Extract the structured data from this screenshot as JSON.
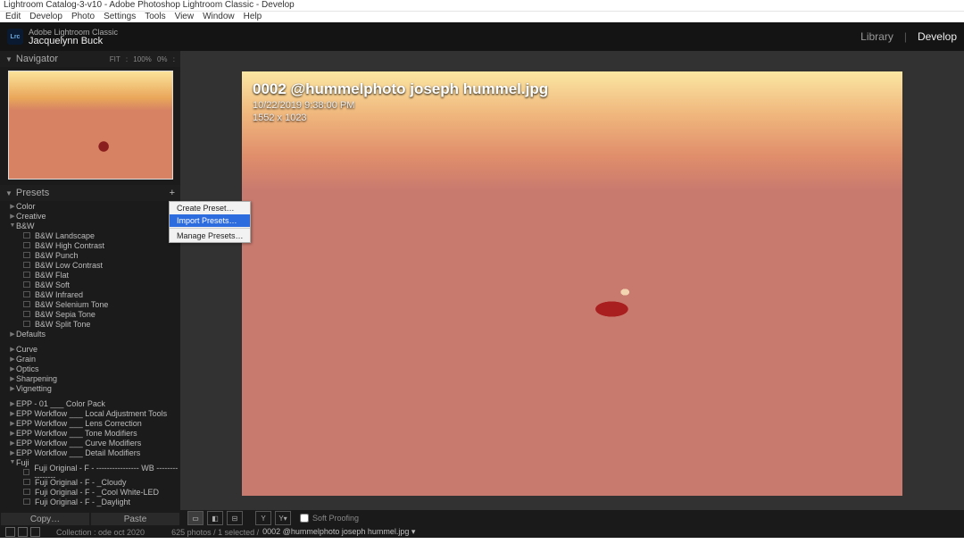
{
  "window_title": "Lightroom Catalog-3-v10 - Adobe Photoshop Lightroom Classic - Develop",
  "menubar": [
    "Edit",
    "Develop",
    "Photo",
    "Settings",
    "Tools",
    "View",
    "Window",
    "Help"
  ],
  "identity": {
    "badge": "Lrc",
    "classic": "Adobe Lightroom Classic",
    "user": "Jacquelynn Buck"
  },
  "modules": {
    "library": "Library",
    "develop": "Develop"
  },
  "navigator": {
    "title": "Navigator",
    "zoom": "FIT :   100%   0% :"
  },
  "presets": {
    "title": "Presets",
    "context_menu": {
      "create": "Create Preset…",
      "import": "Import Presets…",
      "manage": "Manage Presets…"
    },
    "groups": [
      {
        "label": "Color",
        "expanded": false,
        "children": []
      },
      {
        "label": "Creative",
        "expanded": false,
        "children": []
      },
      {
        "label": "B&W",
        "expanded": true,
        "children": [
          "B&W Landscape",
          "B&W High Contrast",
          "B&W Punch",
          "B&W Low Contrast",
          "B&W Flat",
          "B&W Soft",
          "B&W Infrared",
          "B&W Selenium Tone",
          "B&W Sepia Tone",
          "B&W Split Tone"
        ]
      },
      {
        "label": "Defaults",
        "expanded": false,
        "children": []
      },
      {
        "label": "",
        "spacer": true
      },
      {
        "label": "Curve",
        "expanded": false,
        "children": []
      },
      {
        "label": "Grain",
        "expanded": false,
        "children": []
      },
      {
        "label": "Optics",
        "expanded": false,
        "children": []
      },
      {
        "label": "Sharpening",
        "expanded": false,
        "children": []
      },
      {
        "label": "Vignetting",
        "expanded": false,
        "children": []
      },
      {
        "label": "",
        "spacer": true
      },
      {
        "label": "EPP - 01 ___ Color Pack",
        "expanded": false,
        "children": []
      },
      {
        "label": "EPP Workflow ___ Local Adjustment Tools",
        "expanded": false,
        "children": []
      },
      {
        "label": "EPP Workflow ___ Lens Correction",
        "expanded": false,
        "children": []
      },
      {
        "label": "EPP Workflow ___ Tone Modifiers",
        "expanded": false,
        "children": []
      },
      {
        "label": "EPP Workflow ___ Curve Modifiers",
        "expanded": false,
        "children": []
      },
      {
        "label": "EPP Workflow ___ Detail Modifiers",
        "expanded": false,
        "children": []
      },
      {
        "label": "Fuji",
        "expanded": true,
        "children": [
          "Fuji Original - F -   ---------------- WB ----------------",
          "Fuji Original - F - _Cloudy",
          "Fuji Original - F - _Cool White-LED",
          "Fuji Original - F - _Daylight"
        ]
      }
    ],
    "copy": "Copy…",
    "paste": "Paste"
  },
  "image": {
    "filename": "0002 @hummelphoto joseph hummel.jpg",
    "datetime": "10/22/2019 9:38:00 PM",
    "dimensions": "1552 x 1023"
  },
  "toolbar": {
    "soft_proofing": "Soft Proofing"
  },
  "status": {
    "collection_label": "Collection : ode oct 2020",
    "counts": "625 photos  / 1 selected  /",
    "current": "0002 @hummelphoto joseph hummel.jpg  ▾"
  }
}
